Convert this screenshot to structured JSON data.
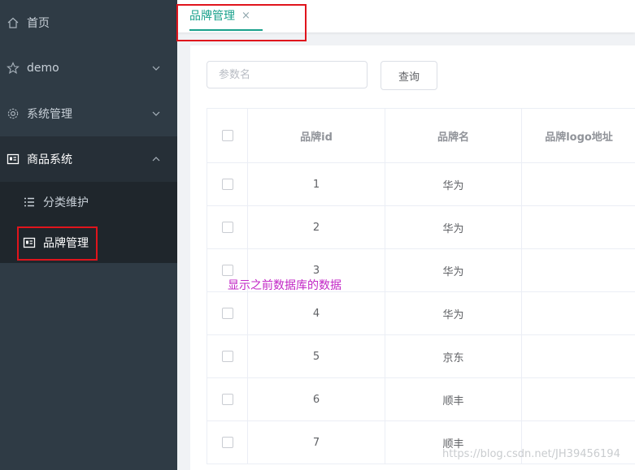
{
  "sidebar": {
    "items": [
      {
        "label": "首页",
        "icon": "home-icon"
      },
      {
        "label": "demo",
        "icon": "star-icon"
      },
      {
        "label": "系统管理",
        "icon": "gear-icon"
      },
      {
        "label": "商品系统",
        "icon": "goods-icon"
      }
    ],
    "submenu": [
      {
        "label": "分类维护",
        "icon": "list-icon"
      },
      {
        "label": "品牌管理",
        "icon": "brand-icon"
      }
    ]
  },
  "tabs": [
    {
      "label": "品牌管理",
      "close": "×"
    }
  ],
  "search": {
    "placeholder": "参数名",
    "button": "查询"
  },
  "table": {
    "headers": [
      "品牌id",
      "品牌名",
      "品牌logo地址"
    ],
    "rows": [
      {
        "id": "1",
        "name": "华为"
      },
      {
        "id": "2",
        "name": "华为"
      },
      {
        "id": "3",
        "name": "华为"
      },
      {
        "id": "4",
        "name": "华为"
      },
      {
        "id": "5",
        "name": "京东"
      },
      {
        "id": "6",
        "name": "顺丰"
      },
      {
        "id": "7",
        "name": "顺丰"
      }
    ]
  },
  "annotation": "显示之前数据库的数据",
  "watermark": "https://blog.csdn.net/JH39456194",
  "colors": {
    "accent": "#1aa18c",
    "highlight_box": "#e0141c",
    "annotation": "#c226c6",
    "sidebar_bg": "#2f3b45"
  }
}
